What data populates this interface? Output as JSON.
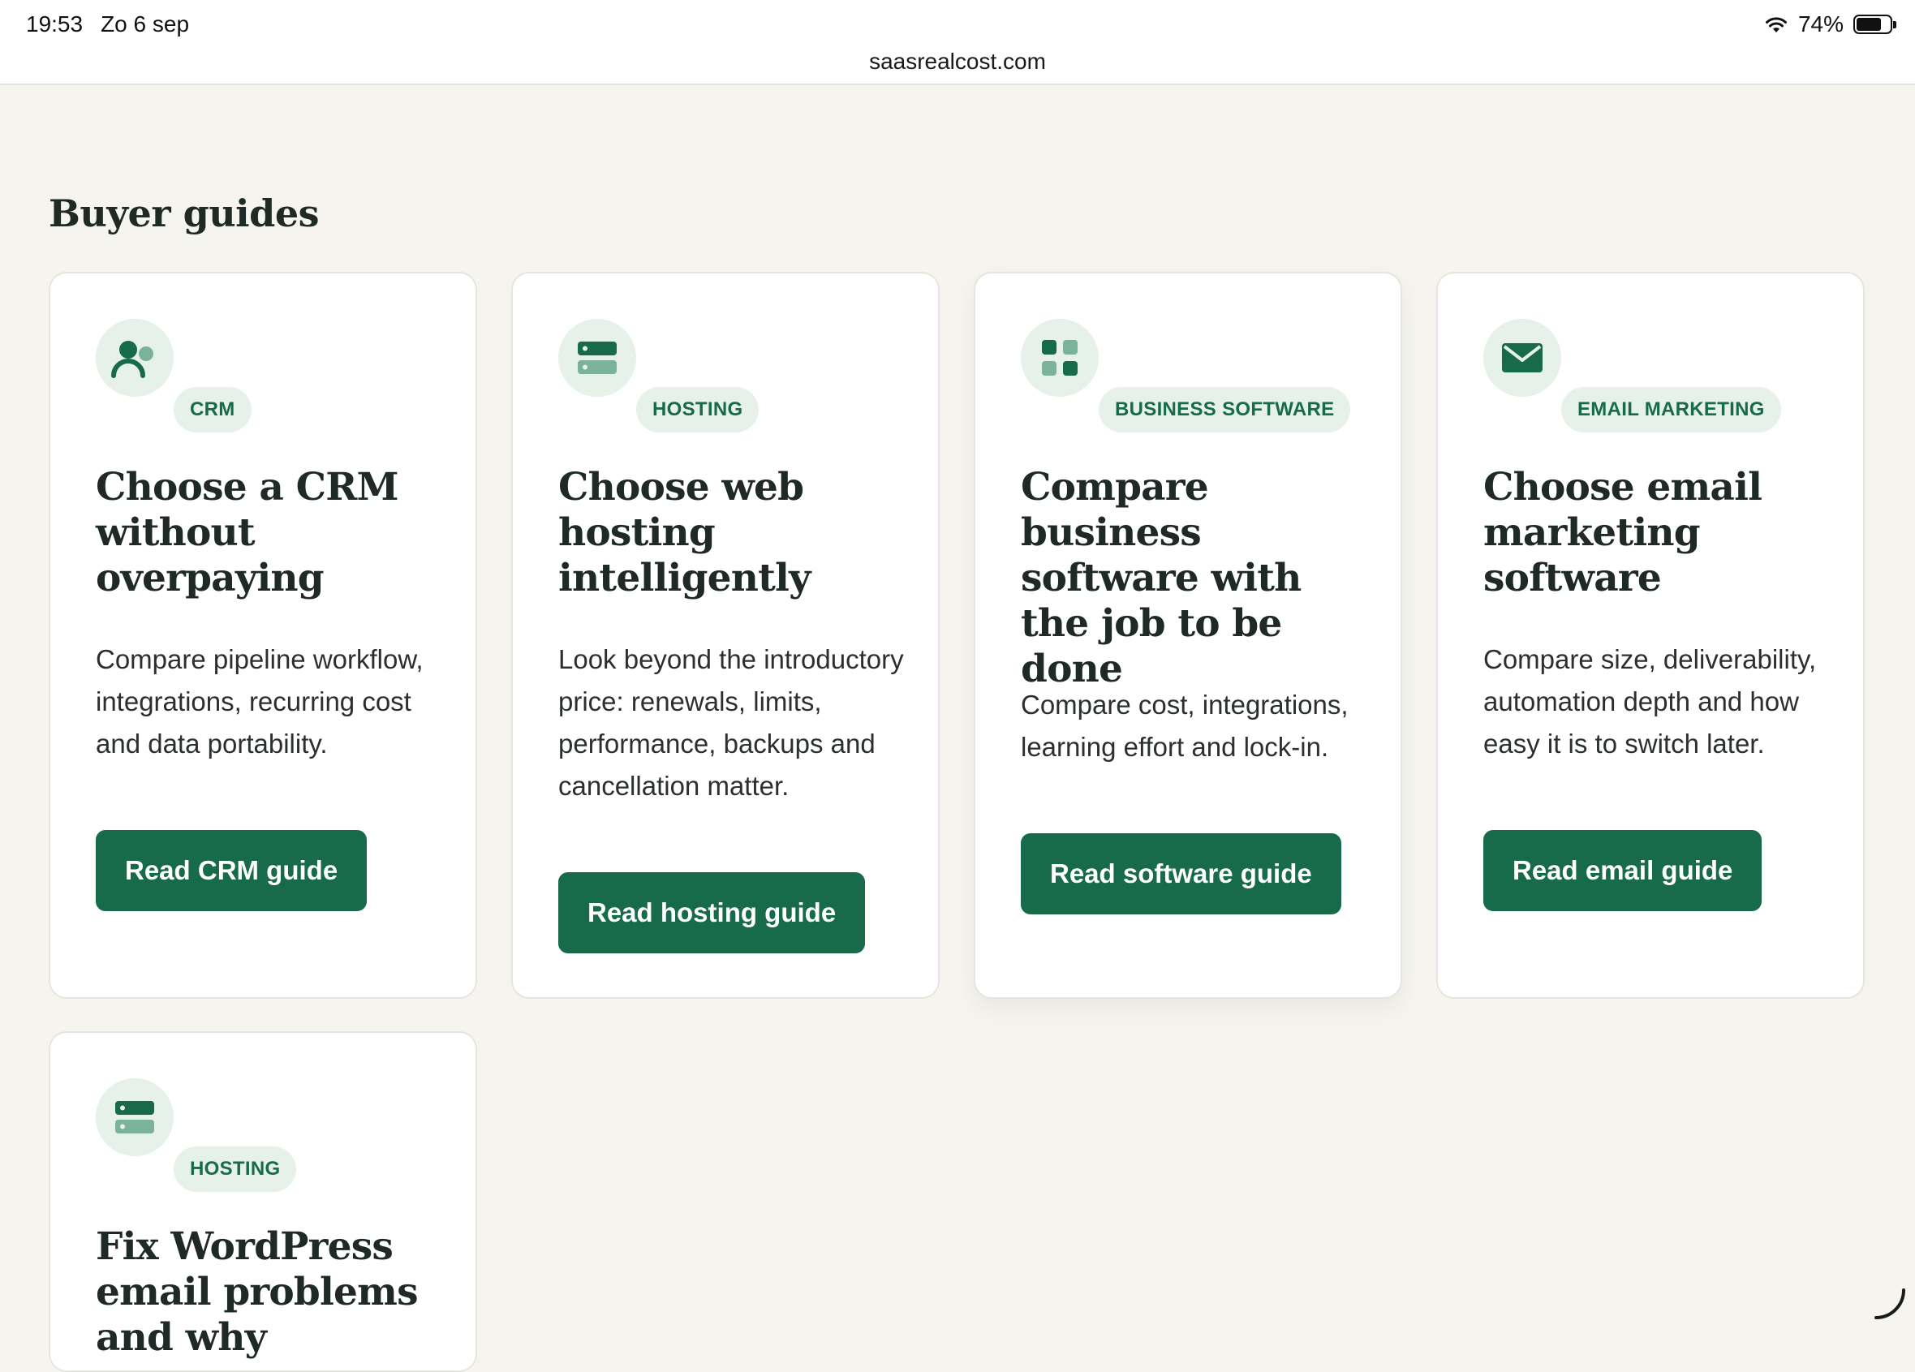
{
  "status_bar": {
    "time": "19:53",
    "date": "Zo 6 sep",
    "battery": "74%",
    "battery_level": 0.74,
    "url": "saasrealcost.com"
  },
  "section": {
    "title": "Buyer guides"
  },
  "cards": [
    {
      "icon": "users-icon",
      "tag": "CRM",
      "title": "Choose a CRM without overpaying",
      "description": "Compare pipeline workflow, integrations, recurring cost and data portability.",
      "button": "Read CRM guide"
    },
    {
      "icon": "server-icon",
      "tag": "HOSTING",
      "title": "Choose web hosting intelligently",
      "description": "Look beyond the introductory price: renewals, limits, performance, backups and cancellation matter.",
      "button": "Read hosting guide"
    },
    {
      "icon": "grid-icon",
      "tag": "BUSINESS SOFTWARE",
      "title": "Compare business software with the job to be done",
      "description": "Compare cost, integrations, learning effort and lock-in.",
      "button": "Read software guide"
    },
    {
      "icon": "mail-icon",
      "tag": "EMAIL MARKETING",
      "title": "Choose email marketing software",
      "description": "Compare size, deliverability, automation depth and how easy it is to switch later.",
      "button": "Read email guide"
    },
    {
      "icon": "server-icon",
      "tag": "HOSTING",
      "title": "Fix WordPress email problems and why"
    }
  ],
  "colors": {
    "accent": "#176a4a",
    "tag_bg": "#e6f1ea",
    "page_bg": "#f5f4ef"
  }
}
